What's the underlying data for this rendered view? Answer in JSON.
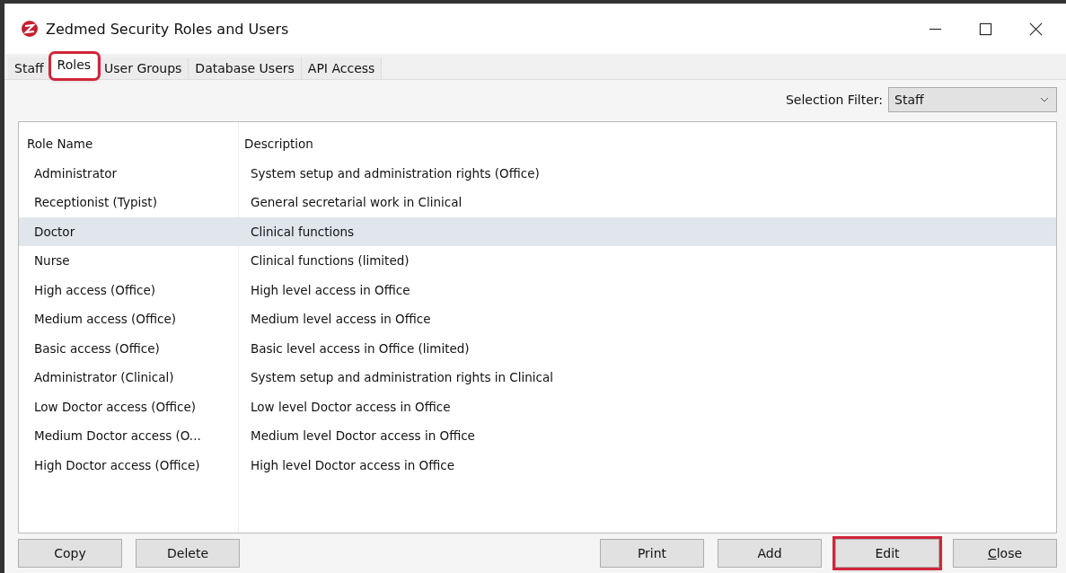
{
  "window": {
    "title": "Zedmed Security Roles and Users"
  },
  "tabs": [
    {
      "label": "Staff",
      "selected": false,
      "highlighted": false
    },
    {
      "label": "Roles",
      "selected": true,
      "highlighted": true
    },
    {
      "label": "User Groups",
      "selected": false,
      "highlighted": false
    },
    {
      "label": "Database Users",
      "selected": false,
      "highlighted": false
    },
    {
      "label": "API Access",
      "selected": false,
      "highlighted": false
    }
  ],
  "selection_filter": {
    "label": "Selection Filter:",
    "value": "Staff"
  },
  "table": {
    "columns": [
      "Role Name",
      "Description"
    ],
    "rows": [
      {
        "cells": [
          "Administrator",
          "System setup and administration rights (Office)"
        ],
        "selected": false
      },
      {
        "cells": [
          "Receptionist (Typist)",
          "General secretarial work in Clinical"
        ],
        "selected": false
      },
      {
        "cells": [
          "Doctor",
          "Clinical functions"
        ],
        "selected": true
      },
      {
        "cells": [
          "Nurse",
          "Clinical functions (limited)"
        ],
        "selected": false
      },
      {
        "cells": [
          "High access (Office)",
          "High level access in Office"
        ],
        "selected": false
      },
      {
        "cells": [
          "Medium access (Office)",
          "Medium level access in Office"
        ],
        "selected": false
      },
      {
        "cells": [
          "Basic access (Office)",
          "Basic level access in Office (limited)"
        ],
        "selected": false
      },
      {
        "cells": [
          "Administrator (Clinical)",
          "System setup and administration rights in Clinical"
        ],
        "selected": false
      },
      {
        "cells": [
          "Low Doctor access (Office)",
          "Low level Doctor access in Office"
        ],
        "selected": false
      },
      {
        "cells": [
          "Medium Doctor access (O...",
          "Medium level Doctor access in Office"
        ],
        "selected": false
      },
      {
        "cells": [
          "High Doctor access (Office)",
          "High level Doctor access in Office"
        ],
        "selected": false
      }
    ]
  },
  "buttons_left": [
    {
      "label": "Copy",
      "highlighted": false,
      "mnemonic_first": false
    },
    {
      "label": "Delete",
      "highlighted": false,
      "mnemonic_first": false
    }
  ],
  "buttons_right": [
    {
      "label": "Print",
      "highlighted": false,
      "mnemonic_first": false
    },
    {
      "label": "Add",
      "highlighted": false,
      "mnemonic_first": false
    },
    {
      "label": "Edit",
      "highlighted": true,
      "mnemonic_first": false
    },
    {
      "label": "Close",
      "highlighted": false,
      "mnemonic_first": true
    }
  ]
}
